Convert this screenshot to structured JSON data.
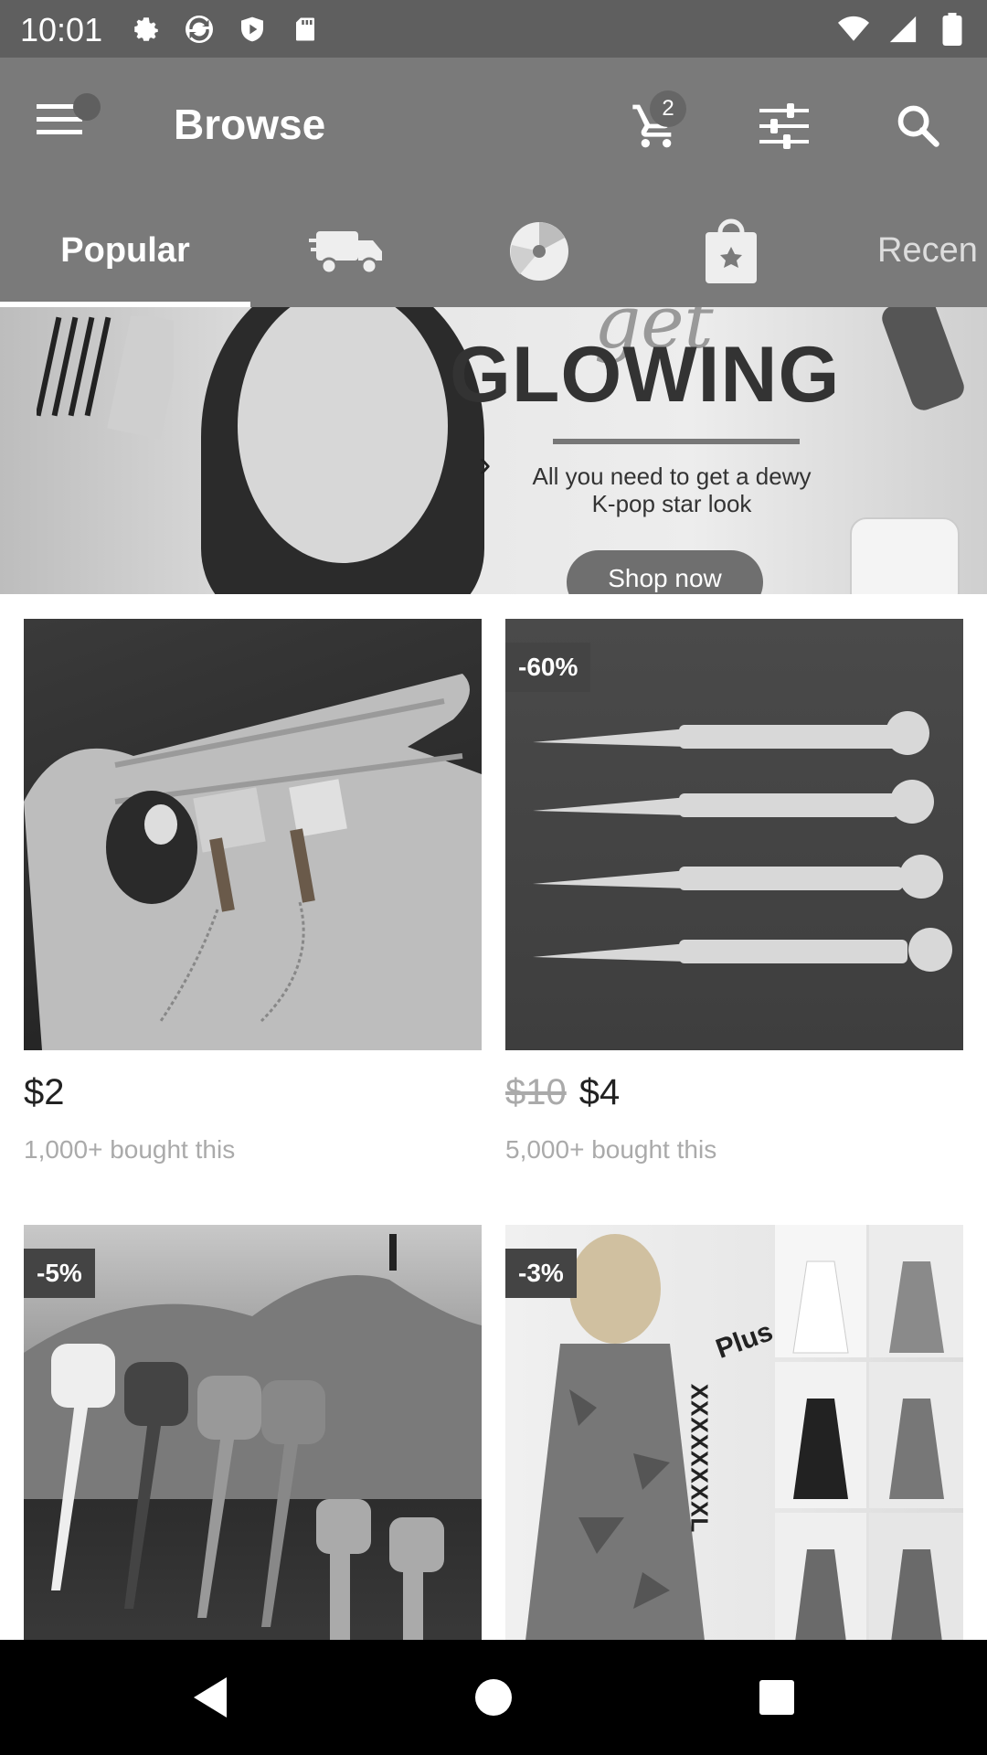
{
  "status_bar": {
    "time": "10:01",
    "left_icons": [
      "gear-icon",
      "sync-icon",
      "shield-play-icon",
      "sd-card-icon"
    ],
    "right_icons": [
      "wifi-icon",
      "signal-icon",
      "battery-icon"
    ]
  },
  "toolbar": {
    "title": "Browse",
    "cart_count": "2",
    "icons": [
      "menu-icon",
      "cart-icon",
      "filter-icon",
      "search-icon"
    ]
  },
  "tabs": {
    "popular": "Popular",
    "truck_icon": "truck-icon",
    "wheel_icon": "wheel-icon",
    "bag_icon": "shopping-bag-star-icon",
    "recent": "Recen"
  },
  "banner": {
    "script": "get",
    "heading": "GLOWING",
    "subtitle_line1": "All you need to get a dewy",
    "subtitle_line2": "K-pop star look",
    "cta": "Shop now"
  },
  "products": [
    {
      "price": "$2",
      "old_price": "",
      "bought": "1,000+ bought this",
      "discount": ""
    },
    {
      "price": "$4",
      "old_price": "$10",
      "bought": "5,000+ bought this",
      "discount": "-60%"
    },
    {
      "price": "",
      "old_price": "",
      "bought": "",
      "discount": "-5%"
    },
    {
      "price": "",
      "old_price": "",
      "bought": "",
      "discount": "-3%"
    }
  ],
  "product4_text": {
    "plus": "Plus",
    "size": "XXXXXXXXL"
  },
  "colors": {
    "toolbar": "#7a7a7a",
    "status_bar": "#5f5f5f",
    "nav_bar": "#000000",
    "badge": "#444444"
  }
}
